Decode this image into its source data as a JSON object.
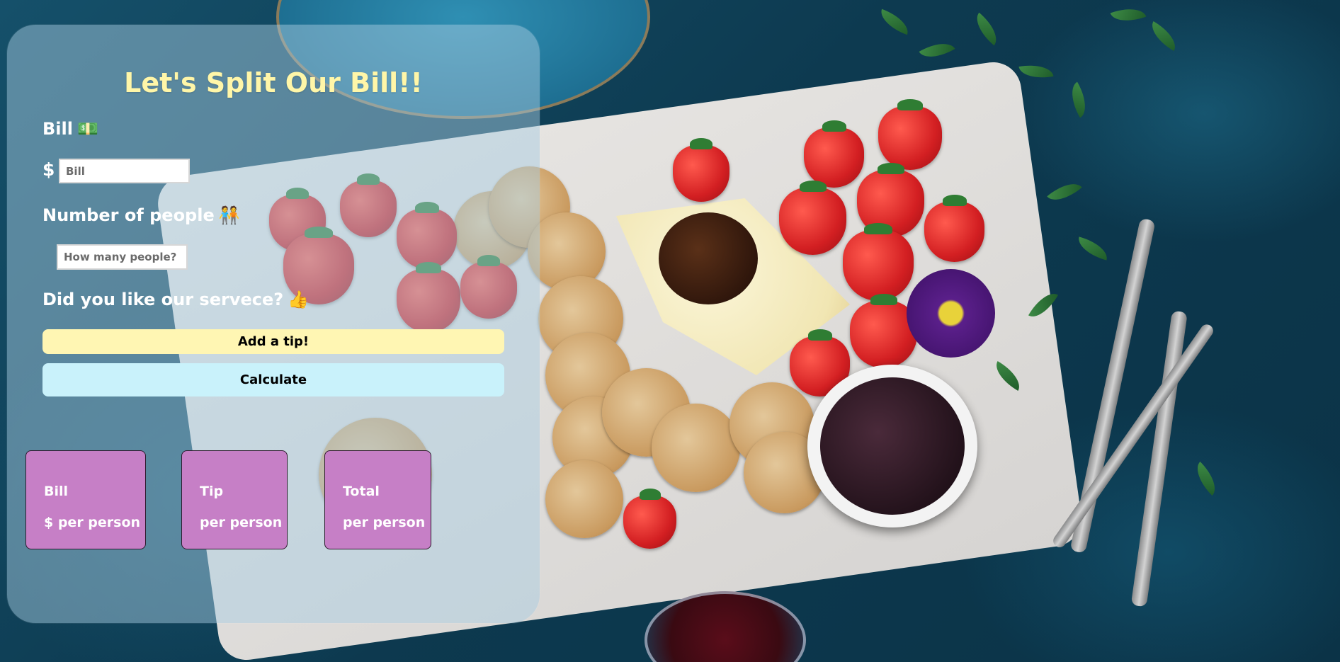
{
  "app": {
    "title": "Let's Split Our Bill!!"
  },
  "bill_section": {
    "label": "Bill",
    "icon": "money-icon",
    "currency_symbol": "$",
    "input_placeholder": "Bill",
    "input_value": ""
  },
  "people_section": {
    "label": "Number of people",
    "icon": "people-icon",
    "input_placeholder": "How many people?",
    "input_value": ""
  },
  "service_section": {
    "label": "Did you like our servece?",
    "icon": "thumbs-up-icon"
  },
  "buttons": {
    "add_tip": "Add a tip!",
    "calculate": "Calculate"
  },
  "results": [
    {
      "title": "Bill",
      "value": "$ per person"
    },
    {
      "title": "Tip",
      "value": "per person"
    },
    {
      "title": "Total",
      "value": "per person"
    }
  ],
  "colors": {
    "title": "#fff6a8",
    "tip_button": "#fff6b3",
    "calculate_button": "#c9f2fb",
    "result_card": "#c67fc6"
  }
}
